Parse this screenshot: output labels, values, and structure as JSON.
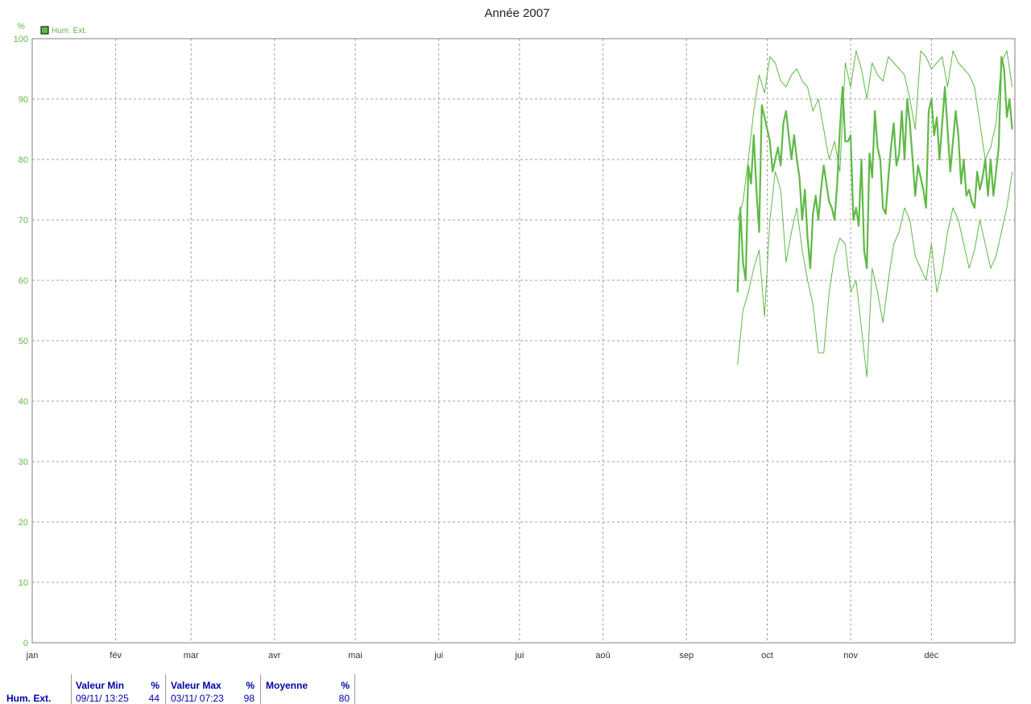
{
  "colors": {
    "series": "#5fb946",
    "axis": "#808080",
    "grid": "#a0a0a0",
    "stats_text": "#0000aa"
  },
  "chart_data": {
    "type": "line",
    "title": "Année 2007",
    "ylabel": "%",
    "ylim": [
      0,
      100
    ],
    "yticks": [
      0,
      10,
      20,
      30,
      40,
      50,
      60,
      70,
      80,
      90,
      100
    ],
    "xlim": [
      "2007-01-01",
      "2008-01-01"
    ],
    "xticks": [
      "2007-01-01",
      "2007-02-01",
      "2007-03-01",
      "2007-04-01",
      "2007-05-01",
      "2007-06-01",
      "2007-07-01",
      "2007-08-01",
      "2007-09-01",
      "2007-10-01",
      "2007-11-01",
      "2007-12-01"
    ],
    "month_labels": [
      "jan",
      "fév",
      "mar",
      "avr",
      "mai",
      "jui",
      "jui",
      "aoû",
      "sep",
      "oct",
      "nov",
      "déc"
    ],
    "grid": true,
    "legend": {
      "placement": "top-left",
      "entries": [
        "Hum. Ext."
      ]
    },
    "series": [
      {
        "name": "Hum. Ext.",
        "role": "moyenne",
        "x": [
          "2007-09-20",
          "2007-09-21",
          "2007-09-22",
          "2007-09-23",
          "2007-09-24",
          "2007-09-25",
          "2007-09-26",
          "2007-09-27",
          "2007-09-28",
          "2007-09-29",
          "2007-09-30",
          "2007-10-01",
          "2007-10-02",
          "2007-10-03",
          "2007-10-04",
          "2007-10-05",
          "2007-10-06",
          "2007-10-07",
          "2007-10-08",
          "2007-10-09",
          "2007-10-10",
          "2007-10-11",
          "2007-10-12",
          "2007-10-13",
          "2007-10-14",
          "2007-10-15",
          "2007-10-16",
          "2007-10-17",
          "2007-10-18",
          "2007-10-19",
          "2007-10-20",
          "2007-10-21",
          "2007-10-22",
          "2007-10-23",
          "2007-10-24",
          "2007-10-25",
          "2007-10-26",
          "2007-10-27",
          "2007-10-28",
          "2007-10-29",
          "2007-10-30",
          "2007-10-31",
          "2007-11-01",
          "2007-11-02",
          "2007-11-03",
          "2007-11-04",
          "2007-11-05",
          "2007-11-06",
          "2007-11-07",
          "2007-11-08",
          "2007-11-09",
          "2007-11-10",
          "2007-11-11",
          "2007-11-12",
          "2007-11-13",
          "2007-11-14",
          "2007-11-15",
          "2007-11-16",
          "2007-11-17",
          "2007-11-18",
          "2007-11-19",
          "2007-11-20",
          "2007-11-21",
          "2007-11-22",
          "2007-11-23",
          "2007-11-24",
          "2007-11-25",
          "2007-11-26",
          "2007-11-27",
          "2007-11-28",
          "2007-11-29",
          "2007-11-30",
          "2007-12-01",
          "2007-12-02",
          "2007-12-03",
          "2007-12-04",
          "2007-12-05",
          "2007-12-06",
          "2007-12-07",
          "2007-12-08",
          "2007-12-09",
          "2007-12-10",
          "2007-12-11",
          "2007-12-12",
          "2007-12-13",
          "2007-12-14",
          "2007-12-15",
          "2007-12-16",
          "2007-12-17",
          "2007-12-18",
          "2007-12-19",
          "2007-12-20",
          "2007-12-21",
          "2007-12-22",
          "2007-12-23",
          "2007-12-24",
          "2007-12-25",
          "2007-12-26",
          "2007-12-27",
          "2007-12-28",
          "2007-12-29",
          "2007-12-30",
          "2007-12-31"
        ],
        "y": [
          58,
          72,
          63,
          60,
          79,
          76,
          84,
          75,
          68,
          89,
          87,
          85,
          83,
          78,
          80,
          82,
          79,
          86,
          88,
          84,
          80,
          84,
          80,
          77,
          70,
          75,
          67,
          62,
          71,
          74,
          70,
          75,
          79,
          76,
          73,
          72,
          70,
          76,
          85,
          92,
          83,
          83,
          84,
          70,
          72,
          69,
          80,
          65,
          62,
          81,
          77,
          88,
          82,
          80,
          72,
          71,
          77,
          82,
          86,
          79,
          81,
          88,
          80,
          90,
          86,
          80,
          74,
          79,
          77,
          75,
          72,
          88,
          90,
          84,
          87,
          80,
          86,
          92,
          85,
          78,
          83,
          88,
          84,
          76,
          80,
          74,
          75,
          73,
          72,
          78,
          75,
          77,
          80,
          74,
          80,
          74,
          78,
          82,
          97,
          95,
          87,
          90,
          85
        ]
      },
      {
        "name": "",
        "role": "max",
        "x": [
          "2007-09-20",
          "2007-09-22",
          "2007-09-24",
          "2007-09-26",
          "2007-09-28",
          "2007-09-30",
          "2007-10-02",
          "2007-10-04",
          "2007-10-06",
          "2007-10-08",
          "2007-10-10",
          "2007-10-12",
          "2007-10-14",
          "2007-10-16",
          "2007-10-18",
          "2007-10-20",
          "2007-10-22",
          "2007-10-24",
          "2007-10-26",
          "2007-10-28",
          "2007-10-30",
          "2007-11-01",
          "2007-11-03",
          "2007-11-05",
          "2007-11-07",
          "2007-11-09",
          "2007-11-11",
          "2007-11-13",
          "2007-11-15",
          "2007-11-17",
          "2007-11-19",
          "2007-11-21",
          "2007-11-23",
          "2007-11-25",
          "2007-11-27",
          "2007-11-29",
          "2007-12-01",
          "2007-12-03",
          "2007-12-05",
          "2007-12-07",
          "2007-12-09",
          "2007-12-11",
          "2007-12-13",
          "2007-12-15",
          "2007-12-17",
          "2007-12-19",
          "2007-12-21",
          "2007-12-23",
          "2007-12-25",
          "2007-12-27",
          "2007-12-29",
          "2007-12-31"
        ],
        "y": [
          70,
          73,
          80,
          88,
          94,
          91,
          97,
          96,
          93,
          92,
          94,
          95,
          93,
          92,
          88,
          90,
          85,
          80,
          83,
          78,
          96,
          92,
          98,
          95,
          90,
          96,
          94,
          93,
          97,
          96,
          95,
          94,
          90,
          85,
          98,
          97,
          95,
          96,
          97,
          92,
          98,
          96,
          95,
          94,
          92,
          86,
          80,
          82,
          86,
          96,
          98,
          92
        ]
      },
      {
        "name": "",
        "role": "min",
        "x": [
          "2007-09-20",
          "2007-09-22",
          "2007-09-24",
          "2007-09-26",
          "2007-09-28",
          "2007-09-30",
          "2007-10-02",
          "2007-10-04",
          "2007-10-06",
          "2007-10-08",
          "2007-10-10",
          "2007-10-12",
          "2007-10-14",
          "2007-10-16",
          "2007-10-18",
          "2007-10-20",
          "2007-10-22",
          "2007-10-24",
          "2007-10-26",
          "2007-10-28",
          "2007-10-30",
          "2007-11-01",
          "2007-11-03",
          "2007-11-05",
          "2007-11-07",
          "2007-11-09",
          "2007-11-11",
          "2007-11-13",
          "2007-11-15",
          "2007-11-17",
          "2007-11-19",
          "2007-11-21",
          "2007-11-23",
          "2007-11-25",
          "2007-11-27",
          "2007-11-29",
          "2007-12-01",
          "2007-12-03",
          "2007-12-05",
          "2007-12-07",
          "2007-12-09",
          "2007-12-11",
          "2007-12-13",
          "2007-12-15",
          "2007-12-17",
          "2007-12-19",
          "2007-12-21",
          "2007-12-23",
          "2007-12-25",
          "2007-12-27",
          "2007-12-29",
          "2007-12-31"
        ],
        "y": [
          46,
          55,
          58,
          62,
          65,
          54,
          70,
          78,
          75,
          63,
          68,
          72,
          65,
          60,
          56,
          48,
          48,
          58,
          64,
          67,
          66,
          58,
          60,
          52,
          44,
          62,
          58,
          53,
          60,
          66,
          68,
          72,
          70,
          64,
          62,
          60,
          66,
          58,
          62,
          68,
          72,
          70,
          66,
          62,
          65,
          70,
          66,
          62,
          64,
          68,
          72,
          78
        ]
      }
    ]
  },
  "stats": {
    "row_label": "Hum. Ext.",
    "min": {
      "header": "Valeur Min",
      "unit": "%",
      "datetime": "09/11/  13:25",
      "value": "44"
    },
    "max": {
      "header": "Valeur Max",
      "unit": "%",
      "datetime": "03/11/  07:23",
      "value": "98"
    },
    "avg": {
      "header": "Moyenne",
      "unit": "%",
      "value": "80"
    }
  }
}
